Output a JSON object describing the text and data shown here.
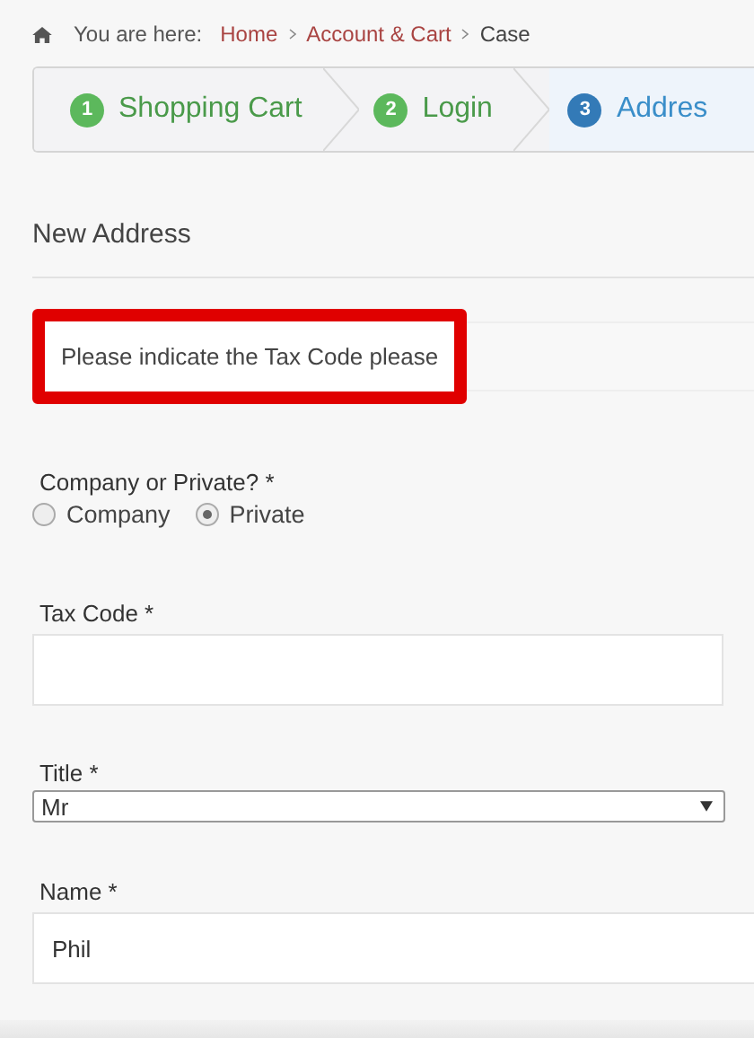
{
  "breadcrumb": {
    "prefix": "You are here:",
    "links": [
      "Home",
      "Account & Cart"
    ],
    "current": "Case"
  },
  "steps": [
    {
      "number": "1",
      "label": "Shopping Cart",
      "selected": false
    },
    {
      "number": "2",
      "label": "Login",
      "selected": false
    },
    {
      "number": "3",
      "label": "Addres",
      "selected": true
    }
  ],
  "section_title": "New Address",
  "alert": "Please indicate the Tax Code please",
  "customer_type": {
    "label": "Company or Private? *",
    "options": [
      {
        "label": "Company",
        "selected": false
      },
      {
        "label": "Private",
        "selected": true
      }
    ]
  },
  "tax_code": {
    "label": "Tax Code *"
  },
  "title_select": {
    "label": "Title *",
    "value": "Mr"
  },
  "name": {
    "label": "Name *",
    "value": "Phil"
  }
}
